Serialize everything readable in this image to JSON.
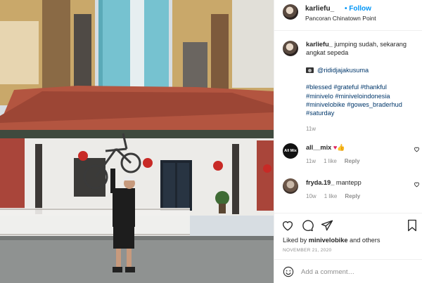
{
  "post": {
    "author": {
      "username": "karliefu_",
      "follow_label": "• Follow",
      "location": "Pancoran Chinatown Point",
      "avatar_icon": "profile-photo"
    },
    "caption": {
      "username": "karliefu_",
      "text": "jumping sudah, sekarang angkat sepeda",
      "camera_icon": "camera-emoji",
      "mention": "@rididjajakusuma",
      "hashtags": [
        "#blessed",
        "#grateful",
        "#thankful",
        "#minivelo",
        "#miniveloindonesia",
        "#minivelobike",
        "#gowes_braderhud",
        "#saturday"
      ],
      "time": "11w"
    },
    "comments": [
      {
        "username": "all__mix",
        "avatar_text": "All Mix",
        "text_emojis": [
          "red-heart",
          "thumbs-up"
        ],
        "time": "11w",
        "likes": "1 like",
        "reply": "Reply"
      },
      {
        "username": "fryda.19_",
        "text": "mantepp",
        "time": "10w",
        "likes": "1 like",
        "reply": "Reply"
      }
    ],
    "liked_by_label": "Liked by",
    "liked_by_user": "minivelobike",
    "liked_by_rest": "and others",
    "date": "NOVEMBER 21, 2020",
    "add_comment_placeholder": "Add a comment…"
  },
  "colors": {
    "accent": "#0095f6",
    "link": "#00376b",
    "muted": "#8e8e8e",
    "text": "#262626",
    "border": "#efefef"
  },
  "icons": {
    "like": "heart-outline-icon",
    "comment": "comment-bubble-icon",
    "share": "paper-plane-icon",
    "save": "bookmark-icon",
    "emoji": "smiley-icon"
  }
}
